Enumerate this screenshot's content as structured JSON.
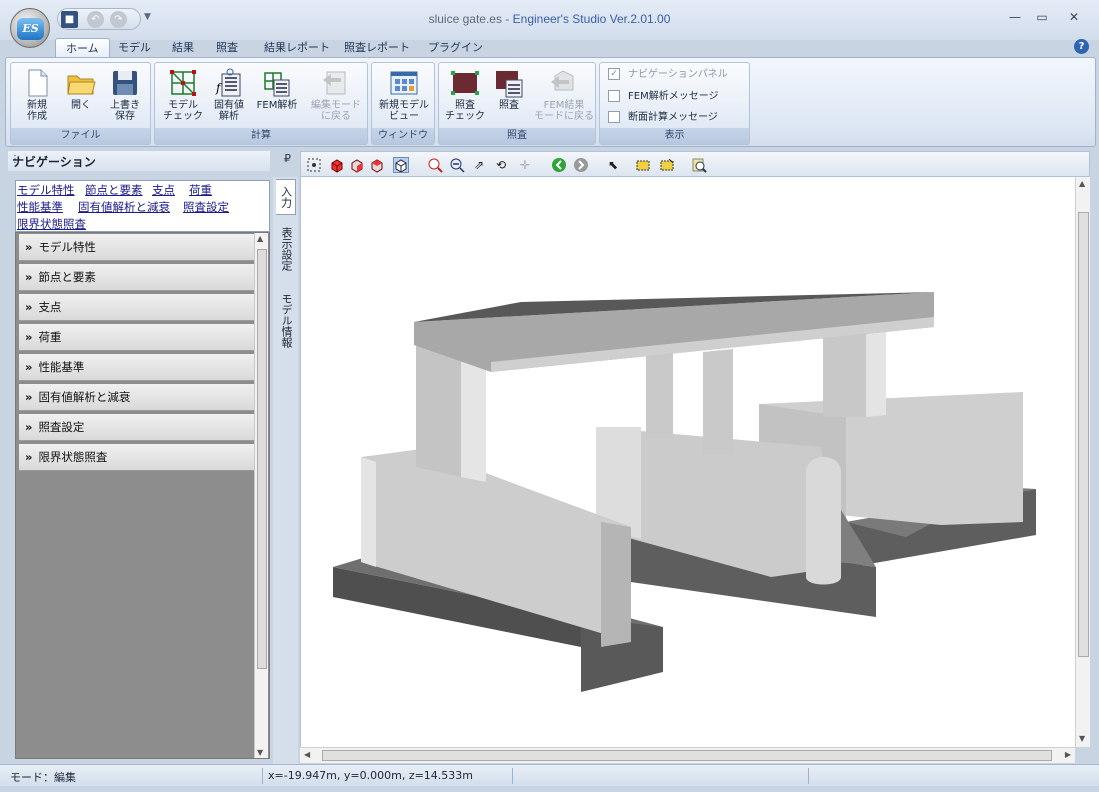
{
  "window": {
    "title_file": "sluice gate.es - ",
    "title_app": "Engineer's Studio Ver.2.01.00",
    "logo_text": "ES",
    "minimize": "—",
    "maximize": "▭",
    "close": "✕"
  },
  "tabs": [
    {
      "label": "ホーム",
      "active": true
    },
    {
      "label": "モデル"
    },
    {
      "label": "結果"
    },
    {
      "label": "照査"
    },
    {
      "label": "結果レポート"
    },
    {
      "label": "照査レポート"
    },
    {
      "label": "プラグイン"
    }
  ],
  "help": "?",
  "ribbon": {
    "file": {
      "label": "ファイル",
      "buttons": [
        {
          "label": "新規\n作成",
          "icon": "new-document-icon"
        },
        {
          "label": "開く",
          "icon": "open-folder-icon"
        },
        {
          "label": "上書き\n保存",
          "icon": "save-disk-icon"
        }
      ]
    },
    "calc": {
      "label": "計算",
      "buttons": [
        {
          "label": "モデル\nチェック",
          "icon": "model-check-icon"
        },
        {
          "label": "固有値\n解析",
          "icon": "eigen-analysis-icon"
        },
        {
          "label": "FEM解析",
          "icon": "fem-analysis-icon"
        },
        {
          "label": "編集モード\nに戻る",
          "icon": "return-edit-mode-icon",
          "disabled": true
        }
      ]
    },
    "window": {
      "label": "ウィンドウ",
      "buttons": [
        {
          "label": "新規モデル\nビュー",
          "icon": "new-model-view-icon"
        }
      ]
    },
    "check": {
      "label": "照査",
      "buttons": [
        {
          "label": "照査\nチェック",
          "icon": "check-verify-icon"
        },
        {
          "label": "照査",
          "icon": "check-icon"
        },
        {
          "label": "FEM結果\nモードに戻る",
          "icon": "fem-result-mode-icon",
          "disabled": true
        }
      ]
    },
    "display": {
      "label": "表示",
      "checks": [
        {
          "label": "ナビゲーションパネル",
          "checked": true,
          "disabled": true
        },
        {
          "label": "FEM解析メッセージ",
          "checked": false
        },
        {
          "label": "断面計算メッセージ",
          "checked": false
        }
      ]
    }
  },
  "navigation": {
    "title": "ナビゲーション",
    "pin": "₽",
    "links": [
      "モデル特性",
      "節点と要素",
      "支点",
      "荷重",
      "性能基準",
      "固有値解析と減衰",
      "照査設定",
      "限界状態照査"
    ],
    "items": [
      "モデル特性",
      "節点と要素",
      "支点",
      "荷重",
      "性能基準",
      "固有値解析と減衰",
      "照査設定",
      "限界状態照査"
    ],
    "arrow": "»"
  },
  "side_tabs": [
    "入力",
    "表示設定",
    "モデル情報"
  ],
  "status": {
    "mode": "モード：編集",
    "coords": "x=-19.947m, y=0.000m, z=14.533m"
  },
  "colors": {
    "accent": "#2d64b4",
    "nav_link": "#1a1a8a",
    "concrete_light": "#d6d6d6",
    "concrete_dark": "#5a5a5a"
  }
}
